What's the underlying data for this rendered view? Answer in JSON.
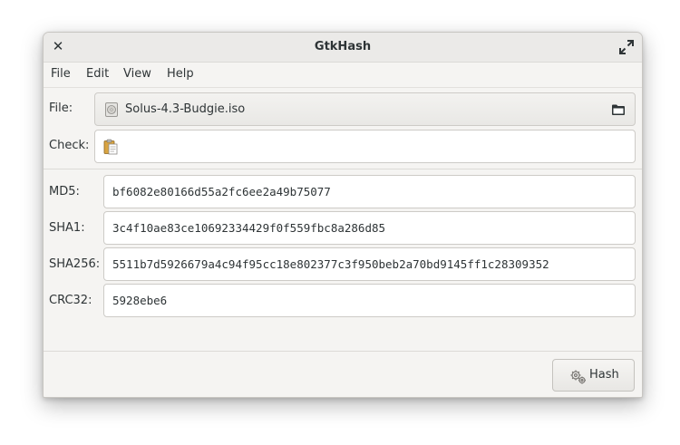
{
  "window": {
    "title": "GtkHash"
  },
  "menubar": {
    "items": [
      "File",
      "Edit",
      "View",
      "Help"
    ]
  },
  "file_row": {
    "label": "File:",
    "selected_file": "Solus-4.3-Budgie.iso",
    "file_icon": "disc-image-icon",
    "open_icon": "folder-icon"
  },
  "check_row": {
    "label": "Check:",
    "value": "",
    "icon": "paste-icon"
  },
  "digests": [
    {
      "label": "MD5:",
      "value": "bf6082e80166d55a2fc6ee2a49b75077"
    },
    {
      "label": "SHA1:",
      "value": "3c4f10ae83ce10692334429f0f559fbc8a286d85"
    },
    {
      "label": "SHA256:",
      "value": "5511b7d5926679a4c94f95cc18e802377c3f950beb2a70bd9145ff1c28309352"
    },
    {
      "label": "CRC32:",
      "value": "5928ebe6"
    }
  ],
  "actions": {
    "hash_label": "Hash",
    "hash_icon": "gears-icon"
  }
}
